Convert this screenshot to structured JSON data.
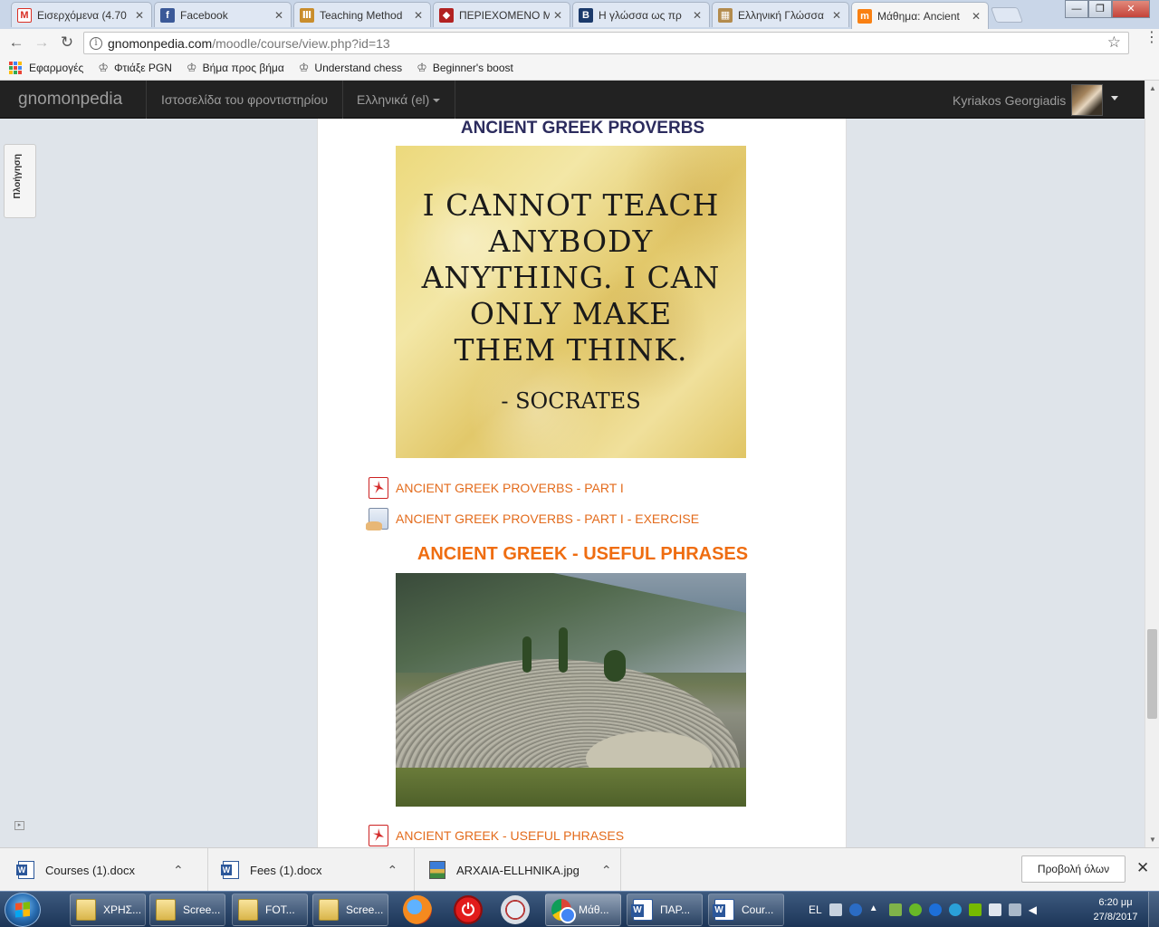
{
  "browser": {
    "tabs": [
      {
        "label": "Εισερχόμενα (4.70",
        "favicon": "gmail-icon",
        "fav_color": "#d93025",
        "fav_glyph": "M"
      },
      {
        "label": "Facebook",
        "favicon": "facebook-icon",
        "fav_color": "#3b5998",
        "fav_glyph": "f"
      },
      {
        "label": "Teaching Method",
        "favicon": "museum-icon",
        "fav_color": "#c98d2c",
        "fav_glyph": "Ⅲ"
      },
      {
        "label": "ΠΕΡΙΕΧΟΜΕΝΟ Μ",
        "favicon": "helmet-icon",
        "fav_color": "#b22222",
        "fav_glyph": "◆"
      },
      {
        "label": "Η γλώσσα ως πρ",
        "favicon": "b-icon",
        "fav_color": "#1b3a6b",
        "fav_glyph": "B"
      },
      {
        "label": "Ελληνική Γλώσσα",
        "favicon": "page-icon",
        "fav_color": "#b38b4d",
        "fav_glyph": "▦"
      },
      {
        "label": "Μάθημα: Ancient",
        "favicon": "moodle-icon",
        "fav_color": "#f98012",
        "fav_glyph": "m"
      }
    ],
    "window_controls": {
      "minimize": "—",
      "maximize": "❐",
      "close": "✕"
    },
    "back": "←",
    "forward": "→",
    "reload": "↻",
    "url_host": "gnomonpedia.com",
    "url_path": "/moodle/course/view.php?id=13",
    "bookmarks": [
      {
        "label": "Εφαρμογές",
        "icon": "apps-grid-icon"
      },
      {
        "label": "Φτιάξε PGN",
        "icon": "chess-crown-icon"
      },
      {
        "label": "Βήμα προς βήμα",
        "icon": "chess-crown-icon"
      },
      {
        "label": "Understand chess",
        "icon": "chess-crown-icon"
      },
      {
        "label": "Beginner's boost",
        "icon": "chess-crown-icon"
      }
    ]
  },
  "navbar": {
    "brand": "gnomonpedia",
    "link_site": "Ιστοσελίδα του φροντιστηρίου",
    "language": "Ελληνικά (el)",
    "username": "Kyriakos Georgiadis"
  },
  "drawer": {
    "label": "Πλοήγηση"
  },
  "course": {
    "section1_title": "ANCIENT GREEK PROVERBS",
    "quote_lines": [
      "I CANNOT TEACH",
      "ANYBODY",
      "ANYTHING. I CAN",
      "ONLY MAKE",
      "THEM THINK."
    ],
    "quote_author": "- SOCRATES",
    "link1": "ANCIENT GREEK PROVERBS - PART I",
    "link2": "ANCIENT GREEK PROVERBS - PART I - EXERCISE",
    "section2_title": "ANCIENT GREEK - USEFUL PHRASES",
    "link3": "ANCIENT GREEK - USEFUL PHRASES"
  },
  "downloads": {
    "items": [
      {
        "name": "Courses (1).docx",
        "icon": "word-doc-icon"
      },
      {
        "name": "Fees (1).docx",
        "icon": "word-doc-icon"
      },
      {
        "name": "ARXAIA-ELLHNIKA.jpg",
        "icon": "image-file-icon"
      }
    ],
    "show_all": "Προβολή όλων"
  },
  "taskbar": {
    "windows": [
      {
        "label": "ΧΡΗΣ...",
        "icon": "folder-icon"
      },
      {
        "label": "Scree...",
        "icon": "folder-icon"
      },
      {
        "label": "FOT...",
        "icon": "folder-icon"
      },
      {
        "label": "Scree...",
        "icon": "folder-icon"
      },
      {
        "label": "Μάθ...",
        "icon": "chrome-icon"
      },
      {
        "label": "ΠΑΡ...",
        "icon": "word-icon"
      },
      {
        "label": "Cour...",
        "icon": "word-icon"
      }
    ],
    "lang": "EL",
    "time": "6:20 μμ",
    "date": "27/8/2017"
  }
}
